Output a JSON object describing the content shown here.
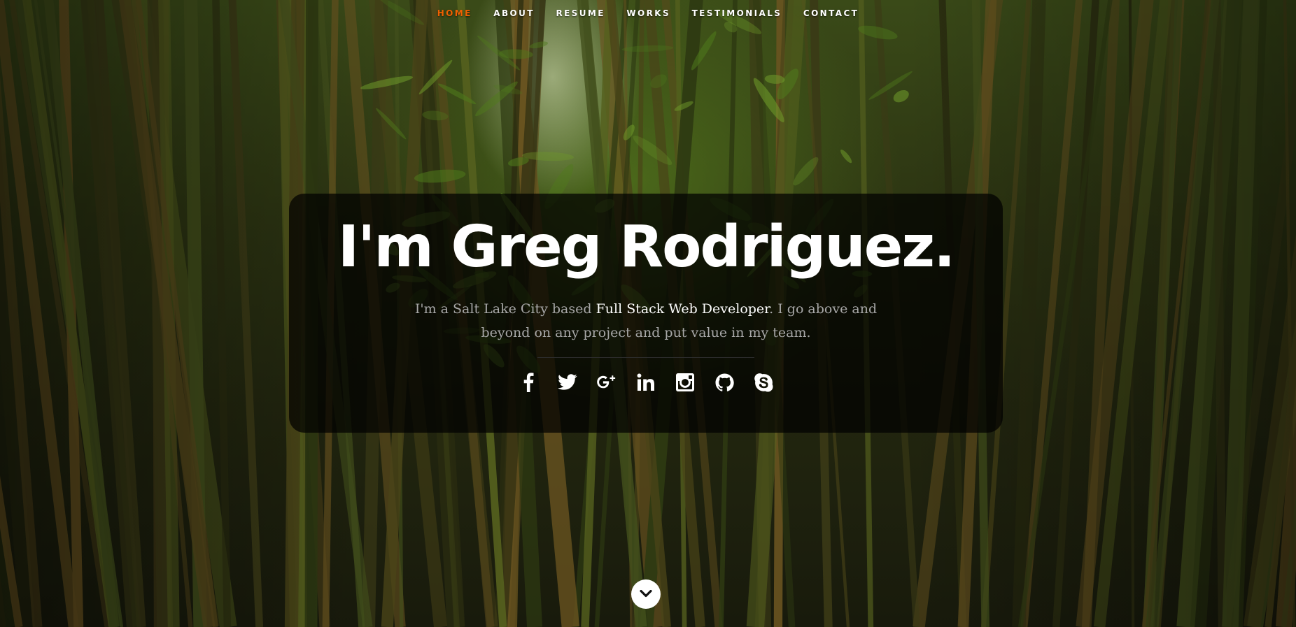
{
  "nav": {
    "items": [
      {
        "label": "HOME",
        "active": true
      },
      {
        "label": "ABOUT",
        "active": false
      },
      {
        "label": "RESUME",
        "active": false
      },
      {
        "label": "WORKS",
        "active": false
      },
      {
        "label": "TESTIMONIALS",
        "active": false
      },
      {
        "label": "CONTACT",
        "active": false
      }
    ],
    "active_color": "#f06000"
  },
  "banner": {
    "headline": "I'm Greg Rodriguez.",
    "intro_before": "I'm a Salt Lake City based ",
    "intro_highlight": "Full Stack Web Developer",
    "intro_after": ". I go above and beyond on any project and put value in my team."
  },
  "social": [
    {
      "icon": "facebook-icon"
    },
    {
      "icon": "twitter-icon"
    },
    {
      "icon": "google-plus-icon"
    },
    {
      "icon": "linkedin-icon"
    },
    {
      "icon": "instagram-icon"
    },
    {
      "icon": "github-icon"
    },
    {
      "icon": "skype-icon"
    }
  ],
  "scroll": {
    "icon": "chevron-down-icon"
  }
}
